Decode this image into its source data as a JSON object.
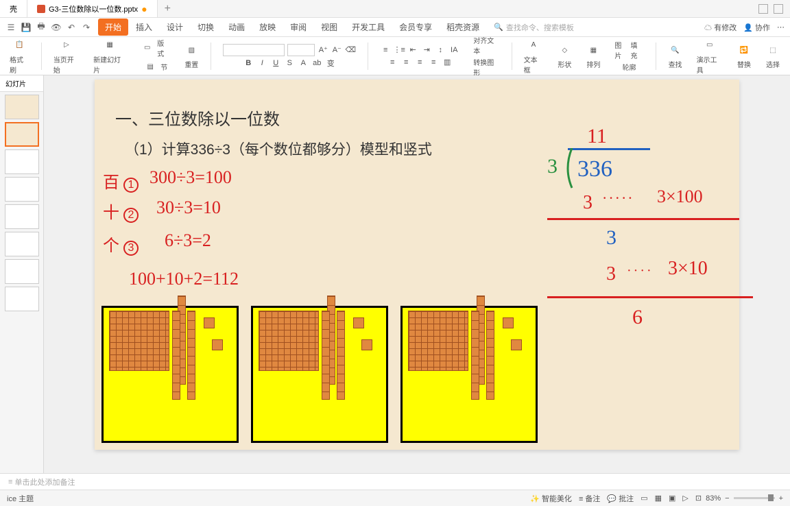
{
  "titlebar": {
    "shell_tab": "壳",
    "file_tab": "G3-三位数除以一位数.pptx"
  },
  "menu": {
    "items": [
      "开始",
      "插入",
      "设计",
      "切换",
      "动画",
      "放映",
      "审阅",
      "视图",
      "开发工具",
      "会员专享",
      "稻壳资源"
    ],
    "search_placeholder": "查找命令、搜索模板",
    "right": {
      "unsaved": "有修改",
      "collab": "协作"
    }
  },
  "toolbar": {
    "paste": "格式刷",
    "play": "当页开始",
    "new_slide": "新建幻灯片",
    "layout": "版式",
    "section": "节",
    "reset": "重置",
    "align_text": "对齐文本",
    "convert": "转换图形",
    "textbox": "文本框",
    "shape": "形状",
    "arrange": "排列",
    "picture": "图片",
    "fill": "填充",
    "outline": "轮廓",
    "find": "查找",
    "presenter": "演示工具",
    "replace": "替换",
    "select": "选择"
  },
  "panel": {
    "tab": "幻灯片"
  },
  "slide": {
    "title": "一、三位数除以一位数",
    "subtitle": "（1）计算336÷3（每个数位都够分）模型和竖式",
    "hand": {
      "bai": "百",
      "shi": "十",
      "ge": "个",
      "l1": "300÷3=100",
      "l2": "30÷3=10",
      "l3": "6÷3=2",
      "sum": "100+10+2=112",
      "quo": "11",
      "divisor": "3",
      "dividend": "336",
      "r1": "3",
      "r1note": "3×100",
      "r2": "3",
      "r3": "3",
      "r3note": "3×10",
      "r4": "6",
      "c1": "1",
      "c2": "2",
      "c3": "3"
    }
  },
  "notes": {
    "placeholder": "单击此处添加备注"
  },
  "status": {
    "theme": "ice 主题",
    "beautify": "智能美化",
    "notes": "备注",
    "comments": "批注",
    "zoom": "83%"
  }
}
